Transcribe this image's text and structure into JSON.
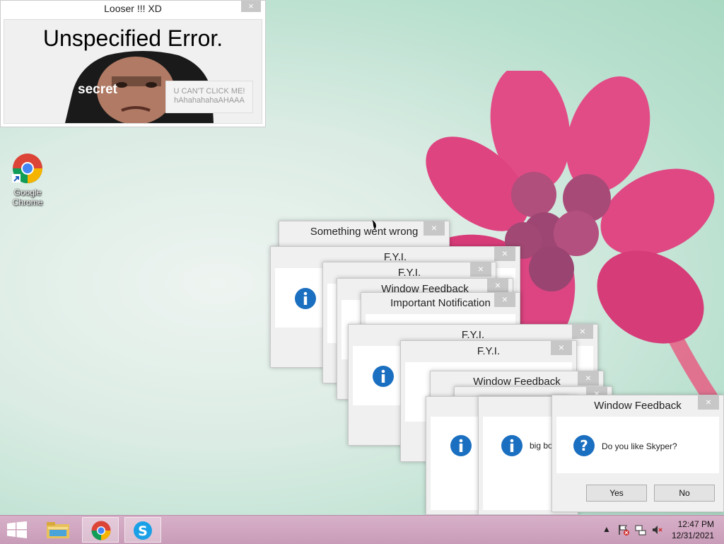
{
  "desktop": {
    "icons": [
      {
        "label": "Google Chrome"
      }
    ]
  },
  "error_window": {
    "title": "Looser !!! XD",
    "close": "×",
    "heading": "Unspecified Error.",
    "secret_label": "secret",
    "button_line1": "U CAN'T CLICK ME!",
    "button_line2": "hAhahahahaAHAAA"
  },
  "windows": [
    {
      "title": "Something went wrong",
      "close": "×"
    },
    {
      "title": "F.Y.I.",
      "close": "×"
    },
    {
      "title": "F.Y.I.",
      "close": "×"
    },
    {
      "title": "Window Feedback",
      "close": "×"
    },
    {
      "title": "Important Notification",
      "close": "×"
    },
    {
      "title": "F.Y.I.",
      "close": "×"
    },
    {
      "title": "F.Y.I.",
      "close": "×"
    },
    {
      "title": "Window Feedback",
      "close": "×"
    },
    {
      "title": "Window Feedback",
      "close": "×",
      "message": "Do you like Skyper?",
      "yes": "Yes",
      "no": "No"
    }
  ],
  "partial_message": "big bo",
  "taskbar": {
    "items": [
      "start",
      "file-explorer",
      "google-chrome",
      "skype"
    ],
    "tray_arrow": "▲",
    "time": "12:47 PM",
    "date": "12/31/2021"
  },
  "colors": {
    "info_blue": "#1b6fc0",
    "taskbar": "#c89cb8",
    "flower": "#e2487e"
  }
}
